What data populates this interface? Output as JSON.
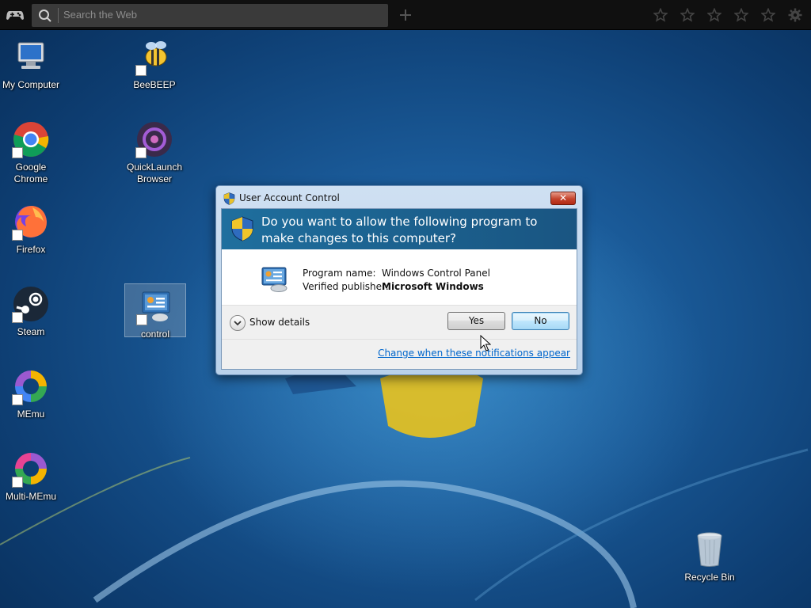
{
  "browser_bar": {
    "search_placeholder": "Search the Web"
  },
  "desktop": {
    "icons": [
      {
        "label": "My Computer"
      },
      {
        "label": "BeeBEEP"
      },
      {
        "label": "Google Chrome"
      },
      {
        "label": "QuickLaunch Browser"
      },
      {
        "label": "Firefox"
      },
      {
        "label": "Steam"
      },
      {
        "label": "control"
      },
      {
        "label": "MEmu"
      },
      {
        "label": "Multi-MEmu"
      },
      {
        "label": "Recycle Bin"
      }
    ]
  },
  "uac_dialog": {
    "title": "User Account Control",
    "close_symbol": "✕",
    "question": "Do you want to allow the following program to make changes to this computer?",
    "program_name_label": "Program name:",
    "program_name_value": "Windows Control Panel",
    "publisher_label": "Verified publisher:",
    "publisher_value": "Microsoft Windows",
    "show_details": "Show details",
    "yes_label": "Yes",
    "no_label": "No",
    "change_link": "Change when these notifications appear"
  },
  "colors": {
    "dialog_header": "#1b5f8c",
    "link": "#0066cc",
    "desktop_bg": "#1a5a98"
  }
}
